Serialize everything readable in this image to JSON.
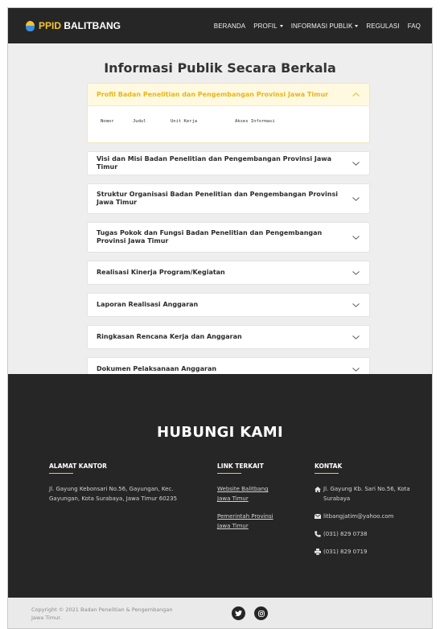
{
  "navbar": {
    "brand_highlight": "PPID",
    "brand_rest": " BALITBANG",
    "items": [
      {
        "label": "BERANDA",
        "dropdown": false
      },
      {
        "label": "PROFIL",
        "dropdown": true
      },
      {
        "label": "INFORMASI PUBLIK",
        "dropdown": true
      },
      {
        "label": "REGULASI",
        "dropdown": false
      },
      {
        "label": "FAQ",
        "dropdown": false
      }
    ]
  },
  "main": {
    "title": "Informasi Publik Secara Berkala",
    "accordion": [
      {
        "title": "Profil Badan Penelitian dan Pengembangan Provinsi Jawa Timur",
        "open": true,
        "columns": [
          "Nomor",
          "Judul",
          "Unit Kerja",
          "Akses Informasi"
        ]
      },
      {
        "title": "Visi dan Misi Badan Penelitian dan Pengembangan Provinsi Jawa Timur",
        "open": false
      },
      {
        "title": "Struktur Organisasi Badan Penelitian dan Pengembangan Provinsi Jawa Timur",
        "open": false
      },
      {
        "title": "Tugas Pokok dan Fungsi Badan Penelitian dan Pengembangan Provinsi Jawa Timur",
        "open": false
      },
      {
        "title": "Realisasi Kinerja Program/Kegiatan",
        "open": false
      },
      {
        "title": "Laporan Realisasi Anggaran",
        "open": false
      },
      {
        "title": "Ringkasan Rencana Kerja dan Anggaran",
        "open": false
      },
      {
        "title": "Dokumen Pelaksanaan Anggaran",
        "open": false
      }
    ]
  },
  "footer": {
    "title": "HUBUNGI KAMI",
    "alamat": {
      "heading": "ALAMAT KANTOR",
      "text": "Jl. Gayung Kebonsari No.56, Gayungan, Kec. Gayungan, Kota Surabaya, Jawa Timur 60235"
    },
    "links": {
      "heading": "LINK TERKAIT",
      "items": [
        "Website Balitbang Jawa Timur",
        "Pemerintah Provinsi Jawa Timur"
      ]
    },
    "kontak": {
      "heading": "KONTAK",
      "address": "Jl. Gayung Kb. Sari No.56, Kota Surabaya",
      "email": "litbangjatim@yahoo.com",
      "phone": "(031) 829 0738",
      "fax": "(031) 829 0719"
    },
    "copyright": "Copyright © 2021 Badan Penelitian & Pengembangan Jawa Timur."
  },
  "colors": {
    "dark": "#262626",
    "accent": "#f4c72b",
    "open_header_bg": "#fff9df",
    "open_title": "#e7b51c"
  },
  "icons": {
    "chevron": "chevron-down-icon",
    "chevron_open": "chevron-up-icon",
    "home": "home-icon",
    "email": "envelope-icon",
    "phone": "phone-icon",
    "fax": "printer-icon",
    "twitter": "twitter-icon",
    "instagram": "instagram-icon"
  }
}
